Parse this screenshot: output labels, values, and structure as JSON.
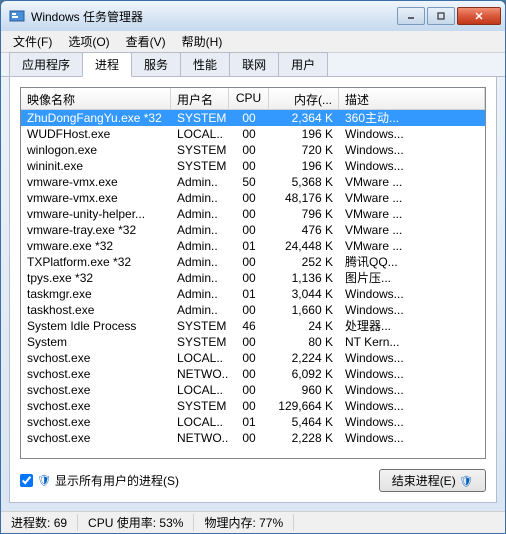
{
  "window": {
    "title": "Windows 任务管理器"
  },
  "menu": {
    "file": "文件(F)",
    "options": "选项(O)",
    "view": "查看(V)",
    "help": "帮助(H)"
  },
  "tabs": {
    "apps": "应用程序",
    "processes": "进程",
    "services": "服务",
    "performance": "性能",
    "network": "联网",
    "users": "用户"
  },
  "columns": {
    "name": "映像名称",
    "user": "用户名",
    "cpu": "CPU",
    "mem": "内存(...",
    "desc": "描述"
  },
  "rows": [
    {
      "name": "ZhuDongFangYu.exe *32",
      "user": "SYSTEM",
      "cpu": "00",
      "mem": "2,364 K",
      "desc": "360主动...",
      "selected": true
    },
    {
      "name": "WUDFHost.exe",
      "user": "LOCAL..",
      "cpu": "00",
      "mem": "196 K",
      "desc": "Windows..."
    },
    {
      "name": "winlogon.exe",
      "user": "SYSTEM",
      "cpu": "00",
      "mem": "720 K",
      "desc": "Windows..."
    },
    {
      "name": "wininit.exe",
      "user": "SYSTEM",
      "cpu": "00",
      "mem": "196 K",
      "desc": "Windows..."
    },
    {
      "name": "vmware-vmx.exe",
      "user": "Admin..",
      "cpu": "50",
      "mem": "5,368 K",
      "desc": "VMware ..."
    },
    {
      "name": "vmware-vmx.exe",
      "user": "Admin..",
      "cpu": "00",
      "mem": "48,176 K",
      "desc": "VMware ..."
    },
    {
      "name": "vmware-unity-helper...",
      "user": "Admin..",
      "cpu": "00",
      "mem": "796 K",
      "desc": "VMware ..."
    },
    {
      "name": "vmware-tray.exe *32",
      "user": "Admin..",
      "cpu": "00",
      "mem": "476 K",
      "desc": "VMware ..."
    },
    {
      "name": "vmware.exe *32",
      "user": "Admin..",
      "cpu": "01",
      "mem": "24,448 K",
      "desc": "VMware ..."
    },
    {
      "name": "TXPlatform.exe *32",
      "user": "Admin..",
      "cpu": "00",
      "mem": "252 K",
      "desc": "腾讯QQ..."
    },
    {
      "name": "tpys.exe *32",
      "user": "Admin..",
      "cpu": "00",
      "mem": "1,136 K",
      "desc": "图片压..."
    },
    {
      "name": "taskmgr.exe",
      "user": "Admin..",
      "cpu": "01",
      "mem": "3,044 K",
      "desc": "Windows..."
    },
    {
      "name": "taskhost.exe",
      "user": "Admin..",
      "cpu": "00",
      "mem": "1,660 K",
      "desc": "Windows..."
    },
    {
      "name": "System Idle Process",
      "user": "SYSTEM",
      "cpu": "46",
      "mem": "24 K",
      "desc": "处理器..."
    },
    {
      "name": "System",
      "user": "SYSTEM",
      "cpu": "00",
      "mem": "80 K",
      "desc": "NT Kern..."
    },
    {
      "name": "svchost.exe",
      "user": "LOCAL..",
      "cpu": "00",
      "mem": "2,224 K",
      "desc": "Windows..."
    },
    {
      "name": "svchost.exe",
      "user": "NETWO..",
      "cpu": "00",
      "mem": "6,092 K",
      "desc": "Windows..."
    },
    {
      "name": "svchost.exe",
      "user": "LOCAL..",
      "cpu": "00",
      "mem": "960 K",
      "desc": "Windows..."
    },
    {
      "name": "svchost.exe",
      "user": "SYSTEM",
      "cpu": "00",
      "mem": "129,664 K",
      "desc": "Windows..."
    },
    {
      "name": "svchost.exe",
      "user": "LOCAL..",
      "cpu": "01",
      "mem": "5,464 K",
      "desc": "Windows..."
    },
    {
      "name": "svchost.exe",
      "user": "NETWO..",
      "cpu": "00",
      "mem": "2,228 K",
      "desc": "Windows..."
    }
  ],
  "footer": {
    "show_all": "显示所有用户的进程(S)",
    "end_process": "结束进程(E)"
  },
  "status": {
    "processes_label": "进程数:",
    "processes_val": "69",
    "cpu_label": "CPU 使用率:",
    "cpu_val": "53%",
    "mem_label": "物理内存:",
    "mem_val": "77%"
  }
}
